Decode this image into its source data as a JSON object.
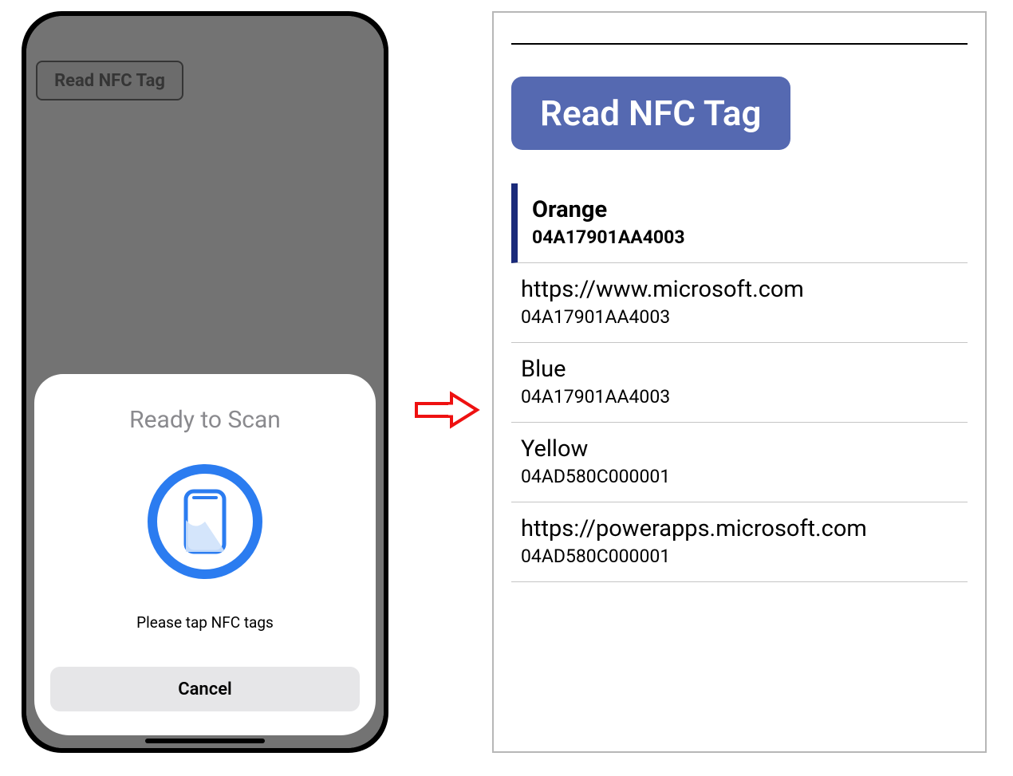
{
  "phone": {
    "bgButton": "Read NFC Tag",
    "sheet": {
      "title": "Ready to Scan",
      "subtitle": "Please tap NFC tags",
      "cancel": "Cancel"
    }
  },
  "right": {
    "button": "Read NFC Tag",
    "items": [
      {
        "title": "Orange",
        "sub": "04A17901AA4003",
        "selected": true
      },
      {
        "title": "https://www.microsoft.com",
        "sub": "04A17901AA4003",
        "selected": false
      },
      {
        "title": "Blue",
        "sub": "04A17901AA4003",
        "selected": false
      },
      {
        "title": "Yellow",
        "sub": "04AD580C000001",
        "selected": false
      },
      {
        "title": "https://powerapps.microsoft.com",
        "sub": "04AD580C000001",
        "selected": false
      }
    ]
  }
}
